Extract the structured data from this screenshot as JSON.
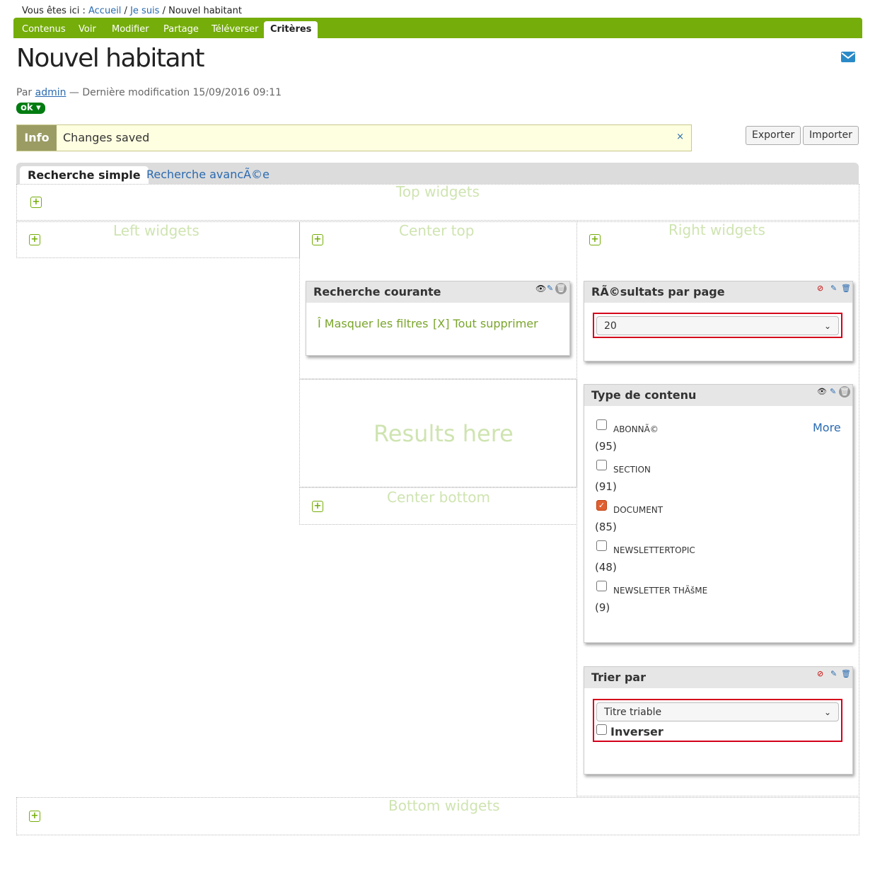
{
  "breadcrumb": {
    "prefix": "Vous êtes ici : ",
    "home": "Accueil",
    "sep": " / ",
    "parent": "Je suis",
    "current": "Nouvel habitant"
  },
  "tabs": [
    "Contenus",
    "Voir",
    "Modifier",
    "Partage",
    "Téléverser",
    "Critères"
  ],
  "page": {
    "title": "Nouvel habitant",
    "by": "Par ",
    "author": "admin",
    "modified": " — Dernière modification 15/09/2016 09:11",
    "state": "ok ▾"
  },
  "info": {
    "label": "Info",
    "message": "Changes saved",
    "close": "×"
  },
  "actions": {
    "export": "Exporter",
    "import": "Importer"
  },
  "search_tabs": {
    "simple": "Recherche simple",
    "advanced": "Recherche avancÃ©e"
  },
  "zones": {
    "top": "Top widgets",
    "left": "Left widgets",
    "center_top": "Center top",
    "right": "Right widgets",
    "results": "Results here",
    "center_bottom": "Center bottom",
    "bottom": "Bottom widgets"
  },
  "widgets": {
    "current_search": {
      "title": "Recherche courante",
      "hide_filters": "Î Masquer les filtres",
      "clear_all": "[X] Tout supprimer"
    },
    "per_page": {
      "title": "RÃ©sultats par page",
      "value": "20"
    },
    "content_type": {
      "title": "Type de contenu",
      "more": "More",
      "items": [
        {
          "label": "ABONNÃ©",
          "count": "(95)",
          "checked": false
        },
        {
          "label": "SECTION",
          "count": "(91)",
          "checked": false
        },
        {
          "label": "DOCUMENT",
          "count": "(85)",
          "checked": true
        },
        {
          "label": "NEWSLETTERTOPIC",
          "count": "(48)",
          "checked": false
        },
        {
          "label": "NEWSLETTER THÃšME",
          "count": "(9)",
          "checked": false
        }
      ]
    },
    "sort": {
      "title": "Trier par",
      "value": "Titre triable",
      "reverse": "Inverser"
    }
  },
  "colors": {
    "accent": "#75ad0a",
    "link": "#2a6ab0",
    "highlight": "#d4001a"
  }
}
